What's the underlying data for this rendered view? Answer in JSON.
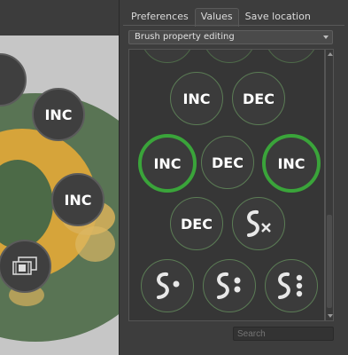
{
  "canvas": {
    "buttons": [
      {
        "label": "INC"
      },
      {
        "label": "INC"
      }
    ]
  },
  "panel": {
    "tabs": [
      {
        "label": "Preferences",
        "active": false
      },
      {
        "label": "Values",
        "active": true
      },
      {
        "label": "Save location",
        "active": false
      }
    ],
    "combo_value": "Brush property editing",
    "grid": {
      "row1": [
        "INC",
        "DEC"
      ],
      "row2": [
        "INC",
        "DEC",
        "INC"
      ],
      "row3": [
        "DEC"
      ]
    },
    "search_placeholder": "Search"
  },
  "colors": {
    "selected_ring": "#3aa43a",
    "ring": "#5b7c55"
  }
}
